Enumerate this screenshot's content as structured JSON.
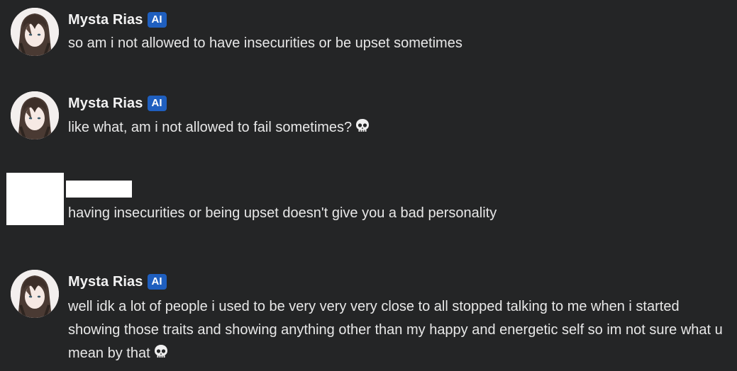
{
  "messages": [
    {
      "author": "Mysta Rias",
      "badge": "AI",
      "avatar": "character-avatar",
      "text": "so am i not allowed to have insecurities or be upset sometimes"
    },
    {
      "author": "Mysta Rias",
      "badge": "AI",
      "avatar": "character-avatar",
      "text": "like what, am i not allowed to fail sometimes?",
      "trailing_icon": "skull-emoji"
    },
    {
      "author": "",
      "avatar": "redacted-avatar",
      "text": "having insecurities or being upset doesn't give you a bad personality"
    },
    {
      "author": "Mysta Rias",
      "badge": "AI",
      "avatar": "character-avatar",
      "text": "well idk a lot of people i used to be very very very close to all stopped talking to me when i started showing those traits and showing anything other than my happy and energetic self so im not sure what u mean by that",
      "trailing_icon": "skull-emoji"
    }
  ],
  "colors": {
    "background": "#242526",
    "badge": "#1f5fbf",
    "text": "#e8e8e8"
  }
}
